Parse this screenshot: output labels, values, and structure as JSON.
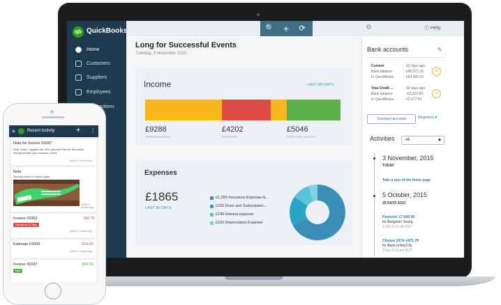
{
  "app": {
    "brand": "QuickBooks",
    "logo_text": "qb"
  },
  "nav": {
    "items": [
      "Home",
      "Customers",
      "Suppliers",
      "Employees",
      "Transactions"
    ]
  },
  "topbar": {
    "search_icon": "🔍",
    "add_icon": "+",
    "refresh_icon": "⟳",
    "gear_icon": "⚙",
    "help": "ⓘ Help"
  },
  "dashboard": {
    "title": "Long for Successful Events",
    "date": "Tuesday, 3 November 2015"
  },
  "income": {
    "title": "Income",
    "range": "LAST 365 DAYS",
    "segments": [
      {
        "label": "OPEN INVOICES",
        "value": "£9288",
        "color": "#f8b81d",
        "share": 0.393
      },
      {
        "label": "OVERDUE",
        "value": "£4202",
        "color": "#e24a48",
        "share": 0.25
      },
      {
        "label": "",
        "value": "",
        "color": "#f8b81d",
        "share": 0.082
      },
      {
        "label": "PAID LAST 30 DAYS",
        "value": "£5046",
        "color": "#5ab149",
        "share": 0.275
      }
    ]
  },
  "expenses": {
    "title": "Expenses",
    "total": "£1865",
    "range": "LAST 30 DAYS",
    "legend": [
      {
        "text": "£1,250 Insurance Expense-G...",
        "color": "#3a8fb7"
      },
      {
        "text": "£325 Dues and Subscription...",
        "color": "#2aa4c4"
      },
      {
        "text": "£190 Interest expense",
        "color": "#59c3d9"
      },
      {
        "text": "£100 Depreciation Expense",
        "color": "#7fd3e2"
      }
    ],
    "donut": [
      {
        "name": "Insurance Expense",
        "value": 1250,
        "color": "#3a8fb7"
      },
      {
        "name": "Dues and Subscriptions",
        "value": 325,
        "color": "#2aa4c4"
      },
      {
        "name": "Interest expense",
        "value": 190,
        "color": "#59c3d9"
      },
      {
        "name": "Depreciation Expense",
        "value": 100,
        "color": "#7fd3e2"
      }
    ]
  },
  "bank": {
    "title": "Bank accounts",
    "edit_icon": "✎",
    "accounts": [
      {
        "name": "Current",
        "ago": "62 days ago",
        "bank_label": "Bank balance",
        "bank": "£40,071.20",
        "qb_label": "In QuickBooks",
        "qb": "£54,500.03",
        "badge": "12"
      },
      {
        "name": "Visa Credit ...",
        "ago": "69 days ago",
        "bank_label": "Bank balance",
        "bank": "-£3,210.00",
        "qb_label": "In QuickBooks",
        "qb": "£2,077.60",
        "badge": "6"
      }
    ],
    "connect": "Connect account",
    "registers": "Registers ▾"
  },
  "activities": {
    "title": "Activities",
    "filter": "All",
    "items": [
      {
        "date": "3 November, 2015",
        "sub": "TODAY"
      },
      {
        "link": "Take a tour of the home page"
      },
      {
        "date": "5 October, 2015",
        "sub": "29 DAYS AGO"
      },
      {
        "link": "Payment: £7,600.00",
        "detail": "for Benjamin Yeung",
        "meta": "5 Oct 3:15 pm BST"
      },
      {
        "link": "Cheque 2074: £471.78",
        "detail": "for Bank of AnyCity",
        "meta": "5 Oct 3:13 pm BST"
      }
    ]
  },
  "phone": {
    "header": "Recent Activity",
    "plus": "+",
    "menu": "⋮",
    "items": [
      {
        "title": "Note for Invoice #1047",
        "body": "Dear Chris: I applied the 10% discount that we discussed. We appreciate you business. Gavin",
        "meta": "Added 5 months ago"
      },
      {
        "title": "Note",
        "body": "Amazing custom 24 electric guitar",
        "meta": "Added 5 months ago"
      },
      {
        "title": "Invoice #1052",
        "amount": "106.75",
        "status": "Overdue by 11 days",
        "meta": "Added 5 months ago"
      },
      {
        "title": "Estimate #1009",
        "amount": "529.00",
        "meta": "Added 5 months ago"
      },
      {
        "title": "Invoice #1037",
        "amount": "958.00",
        "status": "Paid",
        "meta": "Added 5 months ago"
      }
    ]
  }
}
